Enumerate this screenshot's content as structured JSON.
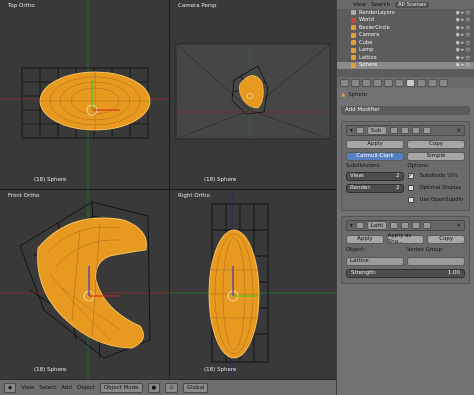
{
  "viewports": {
    "top": {
      "label": "Top Ortho",
      "object": "(18) Sphere"
    },
    "camera": {
      "label": "Camera Persp",
      "object": "(18) Sphere"
    },
    "front": {
      "label": "Front Ortho",
      "object": "(18) Sphere"
    },
    "right": {
      "label": "Right Ortho",
      "object": "(18) Sphere"
    }
  },
  "bottombar": {
    "view": "View",
    "select": "Select",
    "add": "Add",
    "object": "Object",
    "mode": "Object Mode",
    "pivot": "Global"
  },
  "outliner": {
    "view": "View",
    "search": "Search",
    "scene_select": "All Scenes",
    "items": [
      {
        "label": "RenderLayers",
        "color": "#aaaaaa"
      },
      {
        "label": "World",
        "color": "#cc4444"
      },
      {
        "label": "BezierCircle",
        "color": "#e0a040"
      },
      {
        "label": "Camera",
        "color": "#e0a040"
      },
      {
        "label": "Cube",
        "color": "#e0a040"
      },
      {
        "label": "Lamp",
        "color": "#e0a040"
      },
      {
        "label": "Lattice",
        "color": "#e0a040"
      },
      {
        "label": "Sphere",
        "color": "#e0a040"
      }
    ]
  },
  "properties": {
    "object_name": "Sphere",
    "add_modifier": "Add Modifier",
    "subsurf": {
      "name": "Sub",
      "apply": "Apply",
      "copy": "Copy",
      "catmull": "Catmull-Clark",
      "simple": "Simple",
      "subdivisions": "Subdivisions:",
      "view_label": "View:",
      "view_value": "2",
      "render_label": "Render:",
      "render_value": "2",
      "options": "Options:",
      "opt1": "Subdivide UVs",
      "opt2": "Optimal Display",
      "opt3": "Use OpenSubdiv"
    },
    "lattice": {
      "name": "Latti",
      "apply": "Apply",
      "apply_shape": "Apply as Sha...",
      "copy": "Copy",
      "object_label": "Object:",
      "object_value": "Lattice",
      "vgroup_label": "Vertex Group:",
      "strength_label": "Strength:",
      "strength_value": "1.00"
    }
  },
  "colors": {
    "mesh": "#f0a020",
    "lattice": "#111111",
    "viewport_bg": "#393939",
    "accent": "#5680c2"
  }
}
